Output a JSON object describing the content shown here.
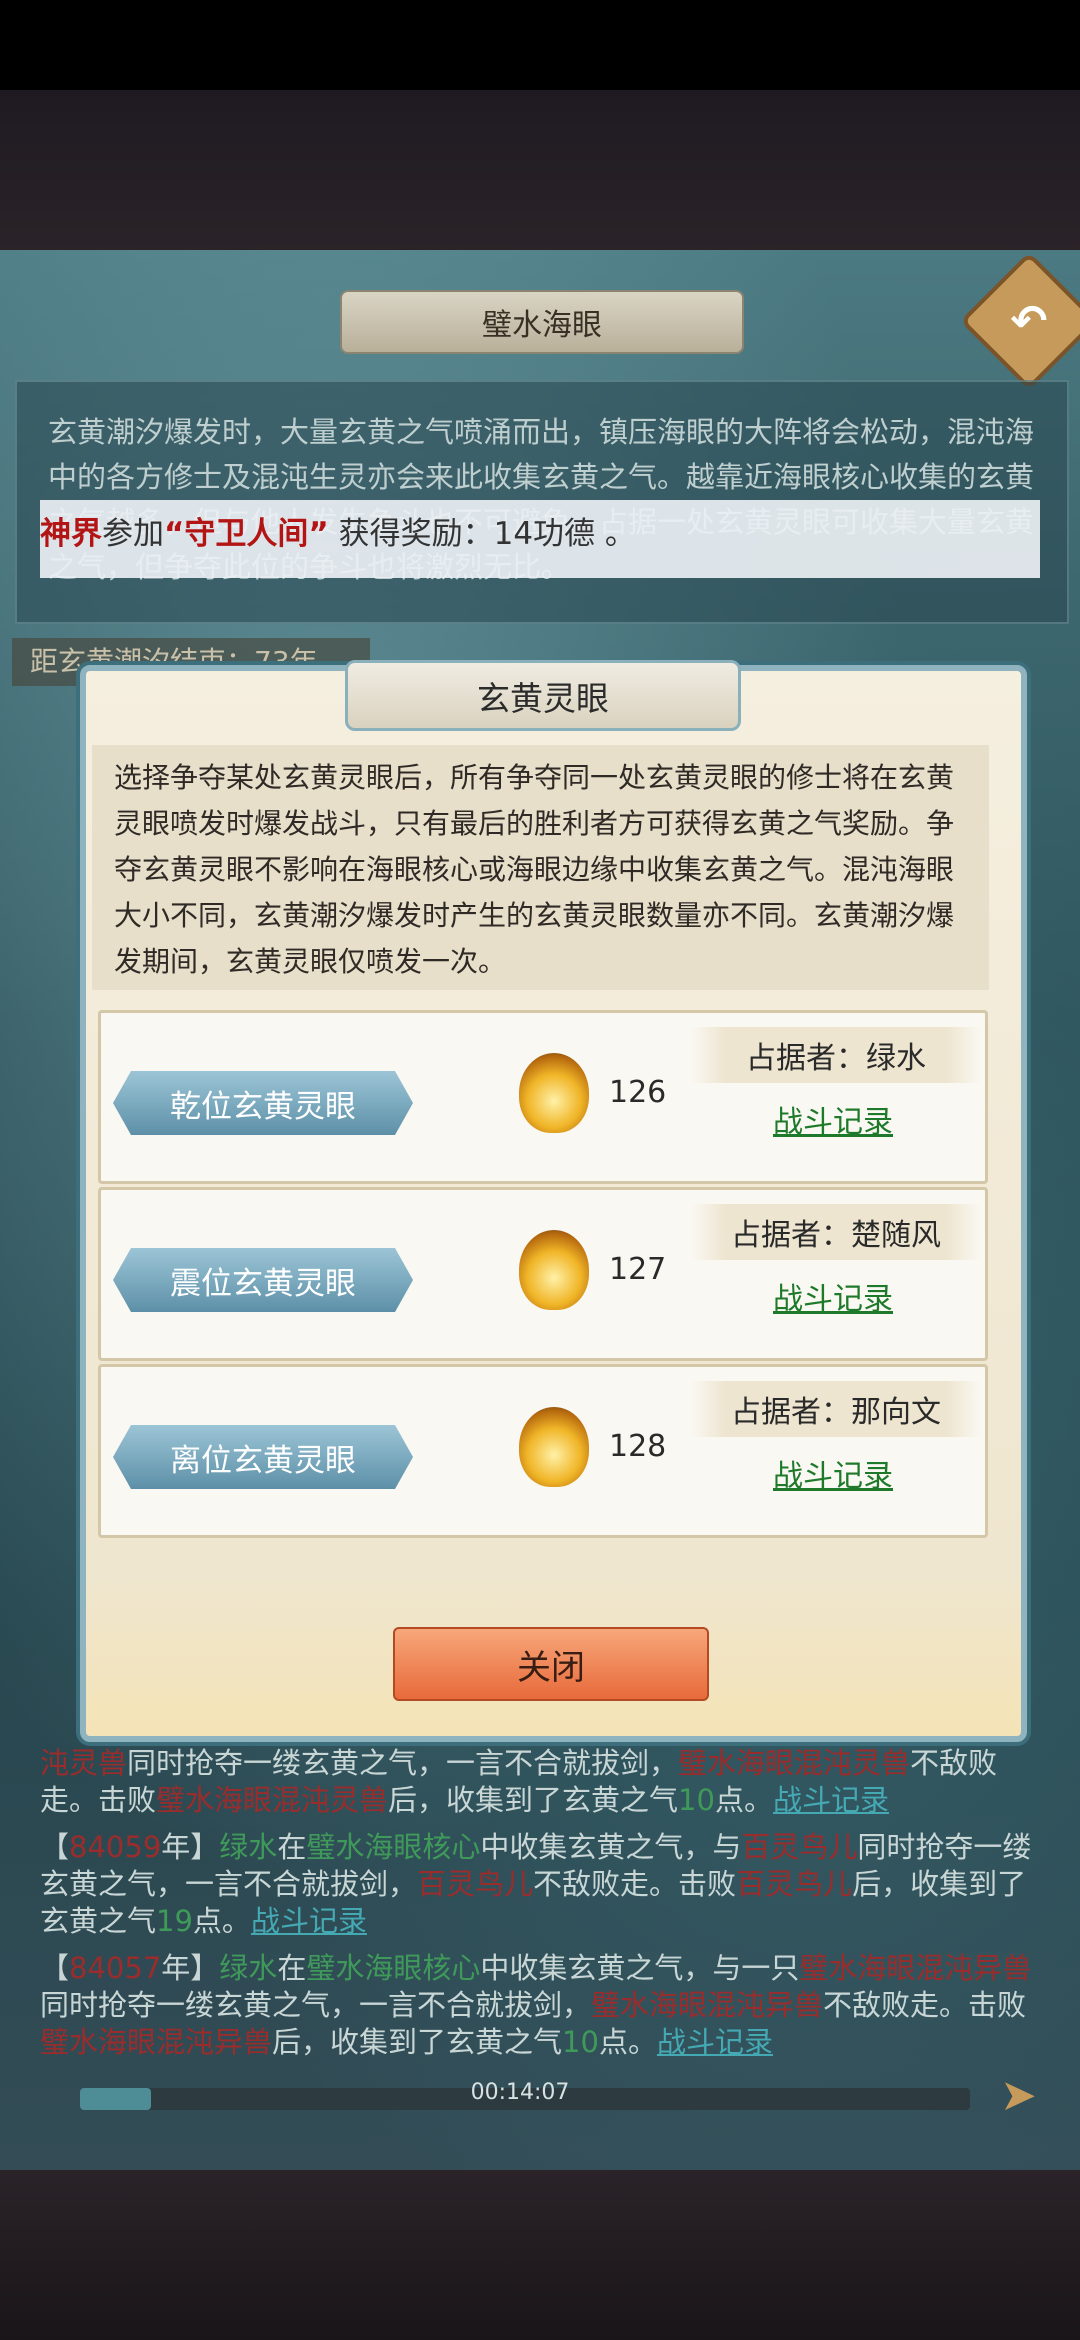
{
  "header": {
    "title": "璧水海眼"
  },
  "description": {
    "text": "玄黄潮汐爆发时，大量玄黄之气喷涌而出，镇压海眼的大阵将会松动，混沌海中的各方修士及混沌生灵亦会来此收集玄黄之气。越靠近海眼核心收集的玄黄之气越多，但与他人发生争斗也不可避免。占据一处玄黄灵眼可收集大量玄黄之气，但争夺此位的争斗也将激烈无比。"
  },
  "reward_banner": {
    "realm": "神界",
    "verb": "参加",
    "event": "“守卫人间”",
    "suffix": " 获得奖励：14功德 。"
  },
  "countdown": {
    "text": "距玄黄潮汐结束：73年"
  },
  "modal": {
    "title": "玄黄灵眼",
    "description": "选择争夺某处玄黄灵眼后，所有争夺同一处玄黄灵眼的修士将在玄黄灵眼喷发时爆发战斗，只有最后的胜利者方可获得玄黄之气奖励。争夺玄黄灵眼不影响在海眼核心或海眼边缘中收集玄黄之气。混沌海眼大小不同，玄黄潮汐爆发时产生的玄黄灵眼数量亦不同。玄黄潮汐爆发期间，玄黄灵眼仅喷发一次。",
    "eyes": [
      {
        "name": "乾位玄黄灵眼",
        "value": "126",
        "occupier": "占据者：绿水",
        "link": "战斗记录"
      },
      {
        "name": "震位玄黄灵眼",
        "value": "127",
        "occupier": "占据者：楚随风",
        "link": "战斗记录"
      },
      {
        "name": "离位玄黄灵眼",
        "value": "128",
        "occupier": "占据者：那向文",
        "link": "战斗记录"
      }
    ],
    "close_label": "关闭"
  },
  "log": [
    {
      "parts": [
        "沌灵兽",
        "同时抢夺一缕玄黄之气，一言不合就拔剑，",
        "璧水海眼混沌灵兽",
        "不敌败走。击败",
        "璧水海眼混沌灵兽",
        "后，收集到了玄黄之气",
        "10",
        "点。",
        "战斗记录"
      ]
    },
    {
      "parts": [
        "【",
        "84059",
        "年】",
        "绿水",
        "在",
        "璧水海眼核心",
        "中收集玄黄之气，与",
        "百灵鸟儿",
        "同时抢夺一缕玄黄之气，一言不合就拔剑，",
        "百灵鸟儿",
        "不敌败走。击败",
        "百灵鸟儿",
        "后，收集到了玄黄之气",
        "19",
        "点。",
        "战斗记录"
      ]
    },
    {
      "parts": [
        "【",
        "84057",
        "年】",
        "绿水",
        "在",
        "璧水海眼核心",
        "中收集玄黄之气，与一只",
        "璧水海眼混沌异兽",
        "同时抢夺一缕玄黄之气，一言不合就拔剑，",
        "璧水海眼混沌异兽",
        "不敌败走。击败",
        "璧水海眼混沌异兽",
        "后，收集到了玄黄之气",
        "10",
        "点。",
        "战斗记录"
      ]
    }
  ],
  "player": {
    "time": "00:14:07",
    "progress": 0.08
  }
}
